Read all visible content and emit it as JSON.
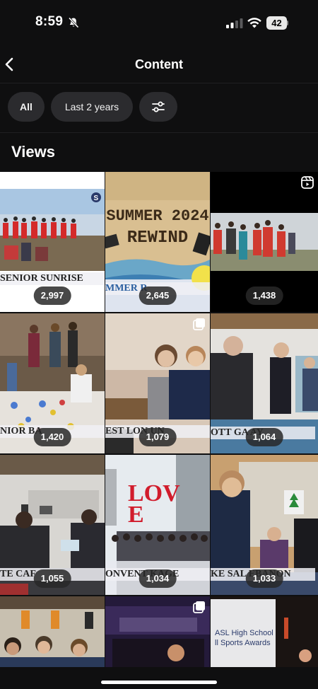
{
  "status": {
    "time": "8:59",
    "battery": "42"
  },
  "nav": {
    "title": "Content"
  },
  "filters": {
    "all": "All",
    "range": "Last 2 years"
  },
  "section": {
    "title": "Views"
  },
  "tiles": [
    {
      "views": "2,997",
      "caption": "SENIOR SUNRISE"
    },
    {
      "views": "2,645",
      "title_line1": "SUMMER 2024",
      "title_line2": "REWIND",
      "caption": "MMER R"
    },
    {
      "views": "1,438"
    },
    {
      "views": "1,420",
      "caption": "NIOR BA"
    },
    {
      "views": "1,079",
      "caption": "EST LON      UN"
    },
    {
      "views": "1,064",
      "caption": "OTT GA      AY"
    },
    {
      "views": "1,055",
      "caption": "TE CAF"
    },
    {
      "views": "1,034",
      "sign": "LOVE",
      "caption": "ONVENT      KAGE"
    },
    {
      "views": "1,033",
      "caption": "KE SAL      EBANON"
    },
    {
      "views": ""
    },
    {
      "views": ""
    },
    {
      "views": "",
      "text_line1": "ASL High School",
      "text_line2": "ll Sports Awards"
    }
  ]
}
